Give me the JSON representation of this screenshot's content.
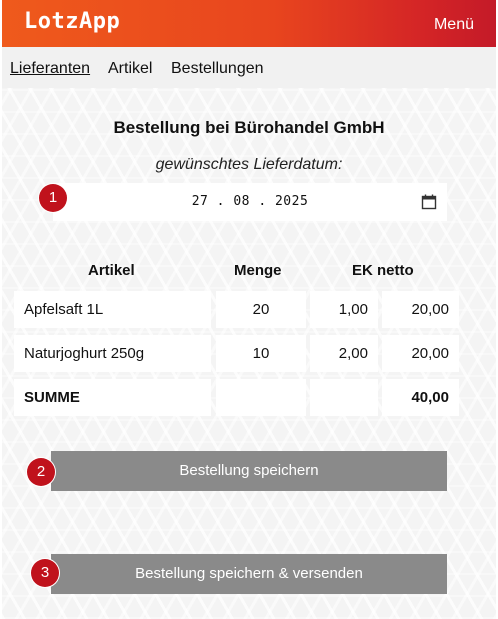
{
  "header": {
    "logo": "LotzApp",
    "menu_label": "Menü"
  },
  "nav": {
    "items": [
      {
        "label": "Lieferanten",
        "active": true
      },
      {
        "label": "Artikel",
        "active": false
      },
      {
        "label": "Bestellungen",
        "active": false
      }
    ]
  },
  "order": {
    "title": "Bestellung bei Bürohandel GmbH",
    "date_label": "gewünschtes Lieferdatum:",
    "date_value": "27 . 08 . 2025",
    "date_icon": "calendar-icon"
  },
  "table": {
    "headers": [
      "Artikel",
      "Menge",
      "EK netto"
    ],
    "rows": [
      {
        "article": "Apfelsaft 1L",
        "quantity": "20",
        "unit_price": "1,00",
        "total": "20,00"
      },
      {
        "article": "Naturjoghurt 250g",
        "quantity": "10",
        "unit_price": "2,00",
        "total": "20,00"
      }
    ],
    "sum_label": "SUMME",
    "sum_value": "40,00"
  },
  "actions": {
    "save_label": "Bestellung speichern",
    "save_send_label": "Bestellung speichern & versenden"
  },
  "badges": [
    "1",
    "2",
    "3"
  ],
  "colors": {
    "header_start": "#ef5a1c",
    "header_end": "#c41a28",
    "badge": "#c0121c",
    "button": "#8a8a8a"
  }
}
